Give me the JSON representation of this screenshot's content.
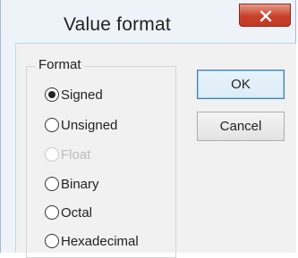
{
  "dialog": {
    "title": "Value format",
    "close_label": "×"
  },
  "format_group": {
    "label": "Format",
    "options": [
      {
        "label": "Signed",
        "selected": true,
        "enabled": true
      },
      {
        "label": "Unsigned",
        "selected": false,
        "enabled": true
      },
      {
        "label": "Float",
        "selected": false,
        "enabled": false
      },
      {
        "label": "Binary",
        "selected": false,
        "enabled": true
      },
      {
        "label": "Octal",
        "selected": false,
        "enabled": true
      },
      {
        "label": "Hexadecimal",
        "selected": false,
        "enabled": true
      }
    ]
  },
  "buttons": {
    "ok_label": "OK",
    "cancel_label": "Cancel"
  },
  "colors": {
    "close_button": "#c9402a",
    "default_button_border": "#3c7fb1",
    "window_frame": "#eef3fa"
  }
}
